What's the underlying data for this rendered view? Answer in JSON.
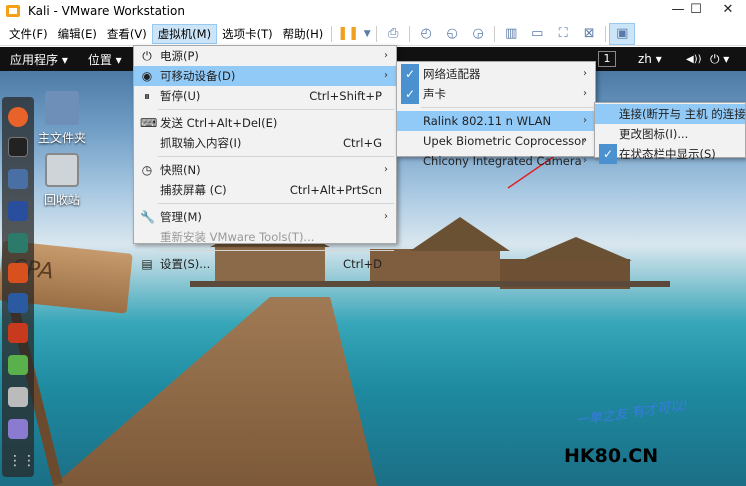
{
  "window": {
    "title": "Kali - VMware Workstation",
    "minimize": "—",
    "maximize": "☐",
    "close": "✕"
  },
  "menubar": [
    "文件(F)",
    "编辑(E)",
    "查看(V)",
    "虚拟机(M)",
    "选项卡(T)",
    "帮助(H)"
  ],
  "guest": {
    "apps": "应用程序 ▾",
    "places": "位置 ▾",
    "workspace": "1",
    "lang": "zh ▾",
    "volume": "◀))",
    "power": "⏻ ▾"
  },
  "desktop": {
    "home": "主文件夹",
    "trash": "回收站",
    "sign": "SPA"
  },
  "vm_menu": [
    {
      "icon": "⏻",
      "label": "电源(P)",
      "shortcut": "",
      "arrow": "›"
    },
    {
      "icon": "◉",
      "label": "可移动设备(D)",
      "shortcut": "",
      "arrow": "›"
    },
    {
      "icon": "⏸",
      "label": "暂停(U)",
      "shortcut": "Ctrl+Shift+P",
      "arrow": ""
    },
    {
      "icon": "⌨",
      "label": "发送 Ctrl+Alt+Del(E)",
      "shortcut": "",
      "arrow": ""
    },
    {
      "icon": "",
      "label": "抓取输入内容(I)",
      "shortcut": "Ctrl+G",
      "arrow": ""
    },
    {
      "icon": "◷",
      "label": "快照(N)",
      "shortcut": "",
      "arrow": "›"
    },
    {
      "icon": "",
      "label": "捕获屏幕 (C)",
      "shortcut": "Ctrl+Alt+PrtScn",
      "arrow": ""
    },
    {
      "icon": "🔧",
      "label": "管理(M)",
      "shortcut": "",
      "arrow": "›"
    },
    {
      "icon": "",
      "label": "重新安装 VMware Tools(T)...",
      "shortcut": "",
      "arrow": ""
    },
    {
      "icon": "▤",
      "label": "设置(S)...",
      "shortcut": "Ctrl+D",
      "arrow": ""
    }
  ],
  "devices_menu": [
    {
      "label": "网络适配器",
      "checked": true
    },
    {
      "label": "声卡",
      "checked": true
    },
    {
      "label": "Ralink 802.11 n WLAN",
      "checked": false
    },
    {
      "label": "Upek Biometric Coprocessor",
      "checked": false
    },
    {
      "label": "Chicony Integrated Camera",
      "checked": false
    }
  ],
  "wlan_menu": [
    {
      "label": "连接(断开与 主机 的连接)(C)",
      "checked": false
    },
    {
      "label": "更改图标(I)...",
      "checked": false
    },
    {
      "label": "在状态栏中显示(S)",
      "checked": true
    }
  ],
  "watermark": {
    "slogan": "一单之友 有才可以!",
    "site": "HK80.CN"
  },
  "colors": {
    "menu_highlight": "#91c9f7",
    "check_bg": "#4b91cf",
    "annotation_arrow": "#e02020"
  }
}
